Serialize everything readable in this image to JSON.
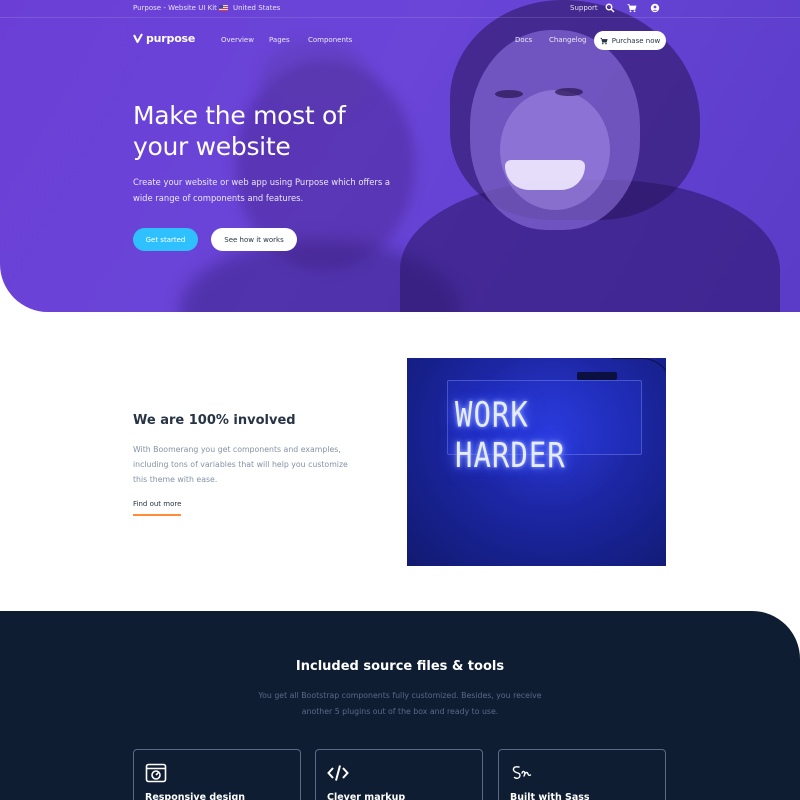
{
  "topbar": {
    "brand_kit": "Purpose - Website UI Kit",
    "country": "United States",
    "support": "Support",
    "icons": [
      "search-icon",
      "cart-icon",
      "user-icon"
    ]
  },
  "navbar": {
    "logo": "purpose",
    "links": [
      "Overview",
      "Pages",
      "Components"
    ],
    "right_links": [
      "Docs",
      "Changelog"
    ],
    "purchase_label": "Purchase now"
  },
  "hero": {
    "title_line1": "Make the most of",
    "title_line2": "your website",
    "lead": "Create your website or web app using Purpose which offers a wide range of components and features.",
    "primary_button": "Get started",
    "secondary_button": "See how it works"
  },
  "involved": {
    "title": "We are 100% involved",
    "text": "With Boomerang you get components and examples, including tons of variables that will help you customize this theme with ease.",
    "link": "Find out more",
    "image_text_line1": "WORK HARDER"
  },
  "tools": {
    "title": "Included source files & tools",
    "text": "You get all Bootstrap components fully customized. Besides, you receive another 5 plugins out of the box and ready to use.",
    "cards": [
      {
        "label": "Responsive design",
        "icon": "browser-gauge-icon"
      },
      {
        "label": "Clever markup",
        "icon": "code-icon"
      },
      {
        "label": "Built with Sass",
        "icon": "sass-icon"
      }
    ]
  },
  "colors": {
    "hero_purple": "#6b3fd6",
    "accent_cyan": "#2fc1ff",
    "accent_orange": "#ff8c3a",
    "dark_navy": "#0f1d33"
  }
}
